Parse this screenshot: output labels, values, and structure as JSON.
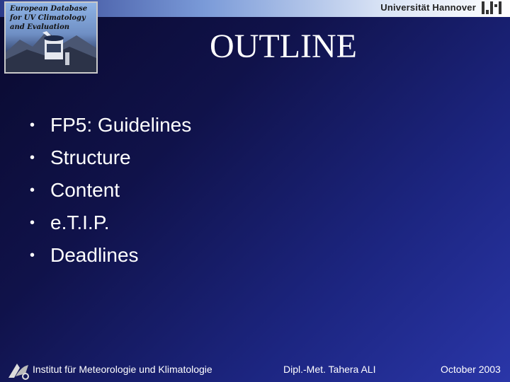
{
  "header": {
    "logo_text": "European Database for UV Climatology and Evaluation",
    "university": "Universität Hannover"
  },
  "slide": {
    "title": "OUTLINE",
    "bullets": [
      "FP5: Guidelines",
      "Structure",
      "Content",
      "e.T.I.P.",
      "Deadlines"
    ]
  },
  "footer": {
    "institute": "Institut für Meteorologie und Klimatologie",
    "author": "Dipl.-Met. Tahera ALI",
    "date": "October 2003"
  },
  "colors": {
    "background": "#1c2580",
    "text": "#ffffff"
  }
}
